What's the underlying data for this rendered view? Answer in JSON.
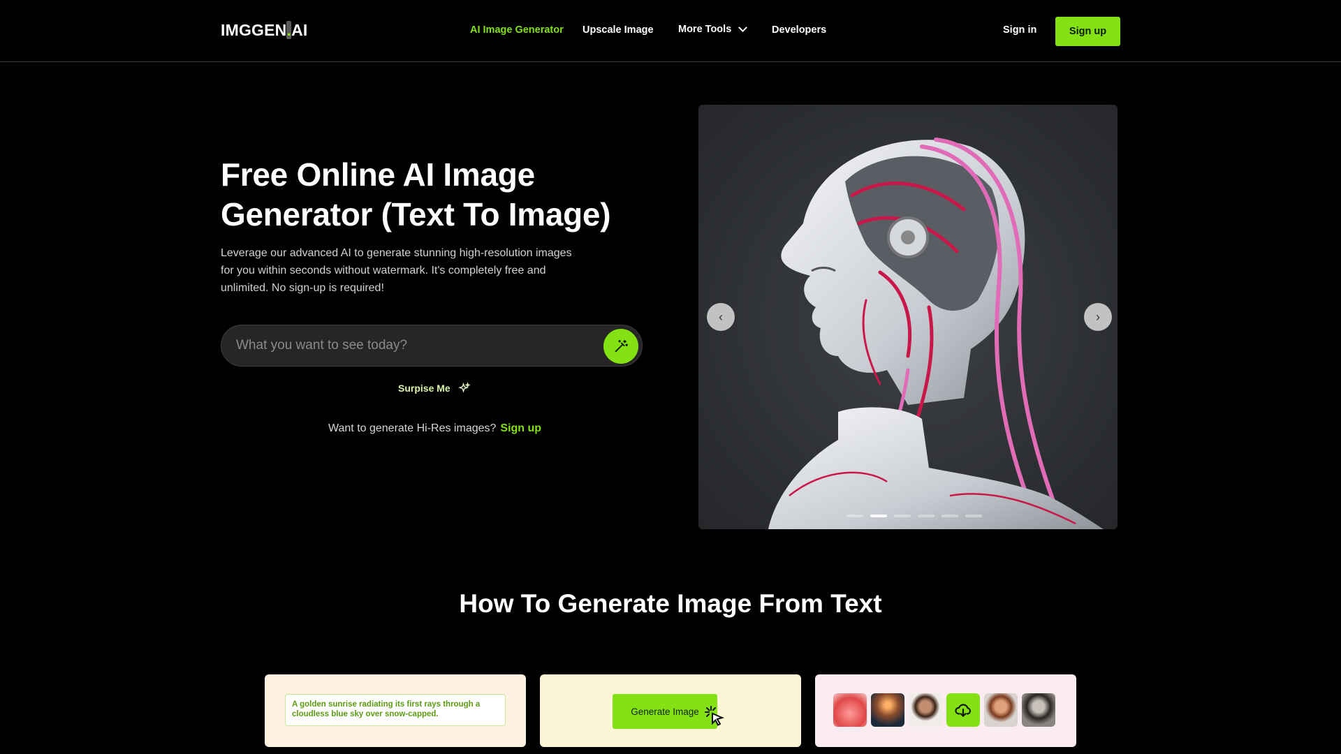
{
  "header": {
    "logo_main": "IMGGEN",
    "logo_dot": ".",
    "logo_suffix": "AI",
    "nav": [
      {
        "label": "AI Image Generator"
      },
      {
        "label": "Upscale Image"
      },
      {
        "label": "More Tools"
      },
      {
        "label": "Developers"
      }
    ],
    "signin_label": "Sign in",
    "signup_label": "Sign up"
  },
  "hero": {
    "title": "Free Online AI Image Generator (Text To Image)",
    "description": "Leverage our advanced AI to generate stunning high-resolution images for you within seconds without watermark. It's completely free and unlimited. No sign-up is required!",
    "search_placeholder": "What you want to see today?",
    "search_value": "",
    "surprise_label": "Surpise Me",
    "hires_text": "Want to generate Hi-Res images?",
    "hires_link": "Sign up"
  },
  "carousel": {
    "slide_count": 6,
    "active_index": 1
  },
  "howto": {
    "title": "How To Generate Image From Text",
    "step1_prompt": "A golden sunrise radiating its first rays through a cloudless blue sky over snow-capped.",
    "step2_button": "Generate Image"
  },
  "colors": {
    "accent": "#84e114",
    "background": "#000000"
  },
  "icons": {
    "magic": "magic-wand-icon",
    "surprise": "sparkle-icon",
    "cursor": "click-cursor-icon",
    "download": "cloud-download-icon"
  }
}
